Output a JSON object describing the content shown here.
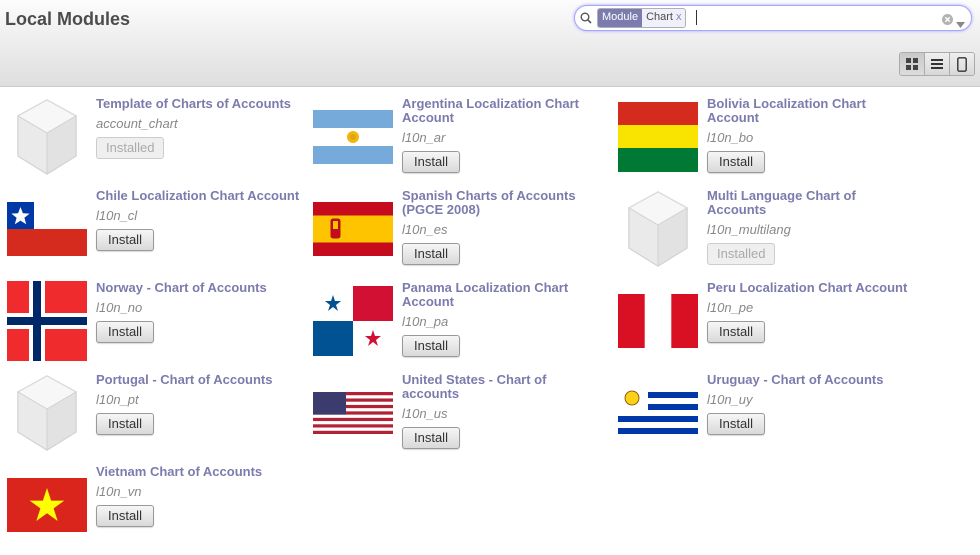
{
  "header": {
    "title": "Local Modules"
  },
  "search": {
    "facet_category": "Module",
    "facet_value": "Chart",
    "facet_remove": "x"
  },
  "views": [
    "kanban-view",
    "list-view",
    "form-view"
  ],
  "modules": [
    {
      "name": "Template of Charts of Accounts",
      "technical": "account_chart",
      "button": "Installed",
      "state": "installed",
      "image": "generic-module-icon"
    },
    {
      "name": "Argentina Localization Chart Account",
      "technical": "l10n_ar",
      "button": "Install",
      "state": "uninstalled",
      "image": "argentina-flag"
    },
    {
      "name": "Bolivia Localization Chart Account",
      "technical": "l10n_bo",
      "button": "Install",
      "state": "uninstalled",
      "image": "bolivia-flag"
    },
    {
      "name": "Chile Localization Chart Account",
      "technical": "l10n_cl",
      "button": "Install",
      "state": "uninstalled",
      "image": "chile-flag"
    },
    {
      "name": "Spanish Charts of Accounts (PGCE 2008)",
      "technical": "l10n_es",
      "button": "Install",
      "state": "uninstalled",
      "image": "spain-flag"
    },
    {
      "name": "Multi Language Chart of Accounts",
      "technical": "l10n_multilang",
      "button": "Installed",
      "state": "installed",
      "image": "generic-module-icon"
    },
    {
      "name": "Norway - Chart of Accounts",
      "technical": "l10n_no",
      "button": "Install",
      "state": "uninstalled",
      "image": "norway-flag"
    },
    {
      "name": "Panama Localization Chart Account",
      "technical": "l10n_pa",
      "button": "Install",
      "state": "uninstalled",
      "image": "panama-flag"
    },
    {
      "name": "Peru Localization Chart Account",
      "technical": "l10n_pe",
      "button": "Install",
      "state": "uninstalled",
      "image": "peru-flag"
    },
    {
      "name": "Portugal - Chart of Accounts",
      "technical": "l10n_pt",
      "button": "Install",
      "state": "uninstalled",
      "image": "generic-module-icon"
    },
    {
      "name": "United States - Chart of accounts",
      "technical": "l10n_us",
      "button": "Install",
      "state": "uninstalled",
      "image": "usa-flag"
    },
    {
      "name": "Uruguay - Chart of Accounts",
      "technical": "l10n_uy",
      "button": "Install",
      "state": "uninstalled",
      "image": "uruguay-flag"
    },
    {
      "name": "Vietnam Chart of Accounts",
      "technical": "l10n_vn",
      "button": "Install",
      "state": "uninstalled",
      "image": "vietnam-flag"
    }
  ],
  "colors": {
    "accent": "#7c7bad",
    "text": "#4c4c4c",
    "technical": "#888888"
  }
}
